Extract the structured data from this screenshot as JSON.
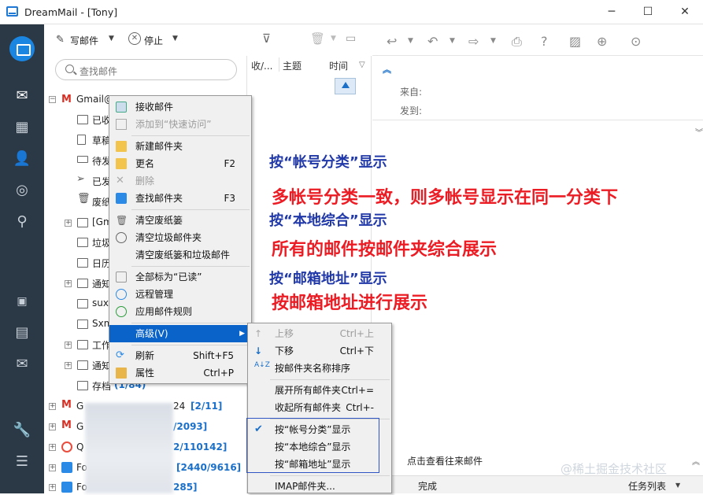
{
  "window": {
    "title": "DreamMail - [Tony]",
    "minimize": "─",
    "maximize": "☐",
    "close": "✕"
  },
  "toolbar": {
    "compose": "写邮件",
    "stop": "停止"
  },
  "search": {
    "placeholder": "查找邮件"
  },
  "folders": {
    "account_gmail": "Gmail@",
    "items": [
      "已收",
      "草稿",
      "待发",
      "已发",
      "废纸"
    ],
    "subfolders": [
      "[Gm",
      "垃圾",
      "日历",
      "通知",
      "suxu",
      "Sxm",
      "工作",
      "通知",
      "存档"
    ],
    "archive_count": "(1/84)"
  },
  "accounts": [
    {
      "prefix": "G",
      "suffix": "24 ",
      "count": "[2/11]"
    },
    {
      "prefix": "G",
      "suffix": "",
      "count": "/2093]"
    },
    {
      "prefix": "Q",
      "suffix": "",
      "count": "2/110142]"
    },
    {
      "prefix": "Fo",
      "suffix": "",
      "count": "[2440/9616]"
    },
    {
      "prefix": "Fo",
      "suffix": "",
      "count": "285]"
    }
  ],
  "message_list": {
    "col_from": "收/...",
    "col_subject": "主题",
    "col_time": "时间"
  },
  "reader": {
    "from_label": "来自:",
    "to_label": "发到:",
    "history_link": "点击查看往来邮件"
  },
  "status": {
    "left": "完成",
    "right": "任务列表"
  },
  "context_menu": [
    {
      "label": "接收邮件",
      "key": "",
      "disabled": false
    },
    {
      "label": "添加到“快速访问”",
      "key": "",
      "disabled": true
    },
    {
      "label": "新建邮件夹",
      "key": "",
      "disabled": false
    },
    {
      "label": "更名",
      "key": "F2",
      "disabled": false
    },
    {
      "label": "删除",
      "key": "",
      "disabled": true
    },
    {
      "label": "查找邮件夹",
      "key": "F3",
      "disabled": false
    },
    {
      "label": "清空废纸篓",
      "key": "",
      "disabled": false
    },
    {
      "label": "清空垃圾邮件夹",
      "key": "",
      "disabled": false
    },
    {
      "label": "清空废纸篓和垃圾邮件",
      "key": "",
      "disabled": false
    },
    {
      "label": "全部标为“已读”",
      "key": "",
      "disabled": false
    },
    {
      "label": "远程管理",
      "key": "",
      "disabled": false
    },
    {
      "label": "应用邮件规则",
      "key": "",
      "disabled": false
    },
    {
      "label": "高级(V)",
      "key": "",
      "disabled": false
    },
    {
      "label": "刷新",
      "key": "Shift+F5",
      "disabled": false
    },
    {
      "label": "属性",
      "key": "Ctrl+P",
      "disabled": false
    }
  ],
  "submenu": [
    {
      "label": "上移",
      "key": "Ctrl+上",
      "disabled": true
    },
    {
      "label": "下移",
      "key": "Ctrl+下",
      "disabled": false
    },
    {
      "label": "按邮件夹名称排序",
      "key": "",
      "disabled": false
    },
    {
      "label": "展开所有邮件夹",
      "key": "Ctrl+=",
      "disabled": false
    },
    {
      "label": "收起所有邮件夹",
      "key": "Ctrl+-",
      "disabled": false
    },
    {
      "label": "按“帐号分类”显示",
      "key": "",
      "disabled": false,
      "checked": true
    },
    {
      "label": "按“本地综合”显示",
      "key": "",
      "disabled": false
    },
    {
      "label": "按“邮箱地址”显示",
      "key": "",
      "disabled": false
    },
    {
      "label": "IMAP邮件夹...",
      "key": "",
      "disabled": false
    }
  ],
  "annotations": {
    "a1": "按“帐号分类”显示",
    "a1_desc": "多帐号分类一致，则多帐号显示在同一分类下",
    "a2": "按“本地综合”显示",
    "a2_desc": "所有的邮件按邮件夹综合展示",
    "a3": "按“邮箱地址”显示",
    "a3_desc": "按邮箱地址进行展示"
  },
  "watermark": "@稀土掘金技术社区",
  "colors": {
    "sidebar": "#2b3845",
    "accent": "#0a63c9",
    "annot_blue": "#2038a8",
    "annot_red": "#ec1c24"
  }
}
